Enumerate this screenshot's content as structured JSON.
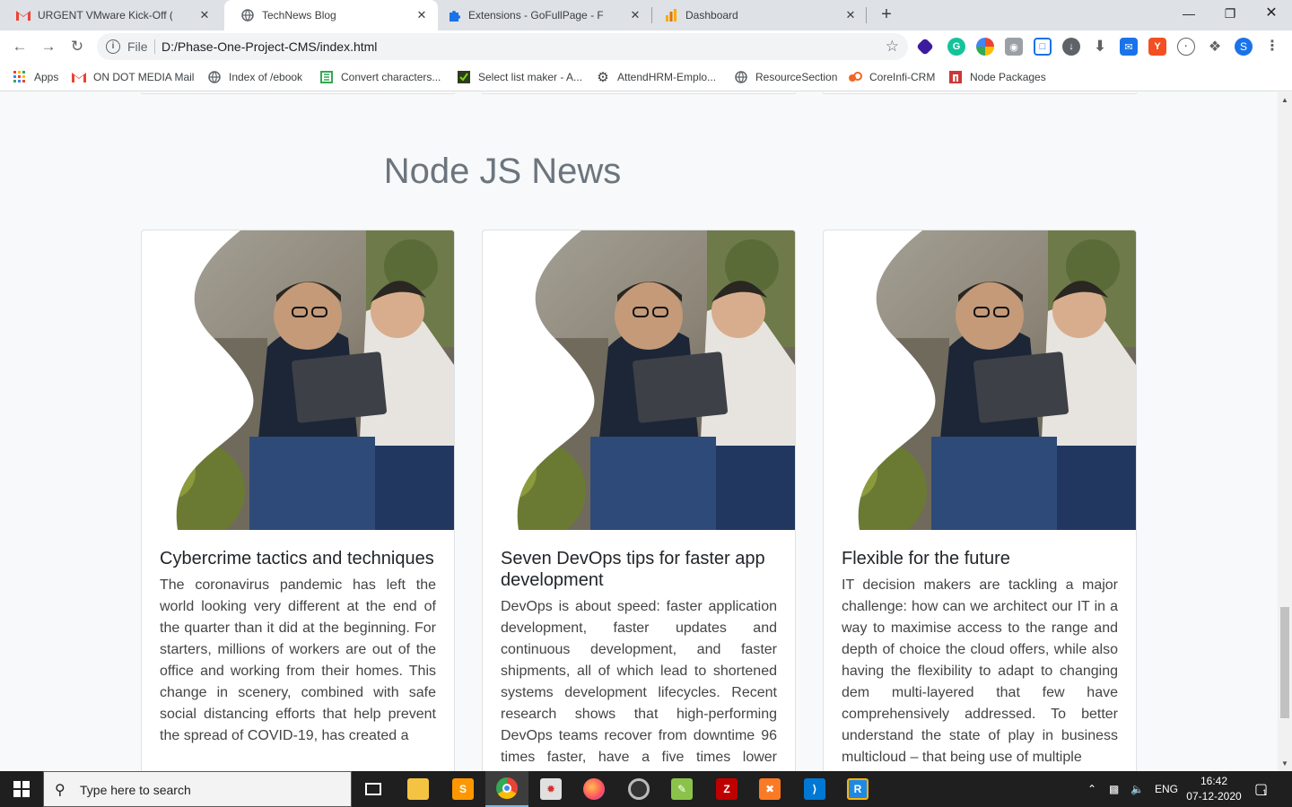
{
  "browser": {
    "tabs": [
      {
        "title": "URGENT VMware Kick-Off (Moan",
        "icon": "gmail-icon",
        "active": false
      },
      {
        "title": "TechNews Blog",
        "icon": "globe-icon",
        "active": true
      },
      {
        "title": "Extensions - GoFullPage - Full Pa",
        "icon": "puzzle-icon",
        "active": false
      },
      {
        "title": "Dashboard",
        "icon": "analytics-icon",
        "active": false
      }
    ],
    "omnibox": {
      "scheme": "File",
      "url": "D:/Phase-One-Project-CMS/index.html"
    },
    "profile_initial": "S",
    "bookmarks": [
      {
        "label": "Apps",
        "icon": "apps-grid-icon"
      },
      {
        "label": "ON DOT MEDIA Mail",
        "icon": "gmail-icon"
      },
      {
        "label": "Index of /ebook",
        "icon": "globe-icon"
      },
      {
        "label": "Convert characters...",
        "icon": "convert-icon"
      },
      {
        "label": "Select list maker - A...",
        "icon": "checkbox-icon"
      },
      {
        "label": "AttendHRM-Emplo...",
        "icon": "gear-icon"
      },
      {
        "label": "ResourceSection",
        "icon": "globe-icon"
      },
      {
        "label": "CoreInfi-CRM",
        "icon": "crm-icon"
      },
      {
        "label": "Node Packages",
        "icon": "npm-icon"
      }
    ]
  },
  "page": {
    "section_title": "Node JS News",
    "cards": [
      {
        "title": "Cybercrime tactics and techniques",
        "text": "The coronavirus pandemic has left the world looking very different at the end of the quarter than it did at the beginning. For starters, millions of workers are out of the office and working from their homes. This change in scenery, combined with safe social distancing efforts that help prevent the spread of COVID-19, has created a"
      },
      {
        "title": "Seven DevOps tips for faster app development",
        "text": "DevOps is about speed: faster application development, faster updates and continuous development, and faster shipments, all of which lead to shortened systems development lifecycles. Recent research shows that high-performing DevOps teams recover from downtime 96 times faster, have a five times lower change"
      },
      {
        "title": "Flexible for the future",
        "text": "IT decision makers are tackling a major challenge: how can we architect our IT in a way to maximise access to the range and depth of choice the cloud offers, while also having the flexibility to adapt to changing dem multi-layered that few have comprehensively addressed. To better understand the state of play in business multicloud – that being use of multiple"
      }
    ]
  },
  "taskbar": {
    "search_placeholder": "Type here to search",
    "language": "ENG",
    "time": "16:42",
    "date": "07-12-2020",
    "notification_count": "1"
  }
}
